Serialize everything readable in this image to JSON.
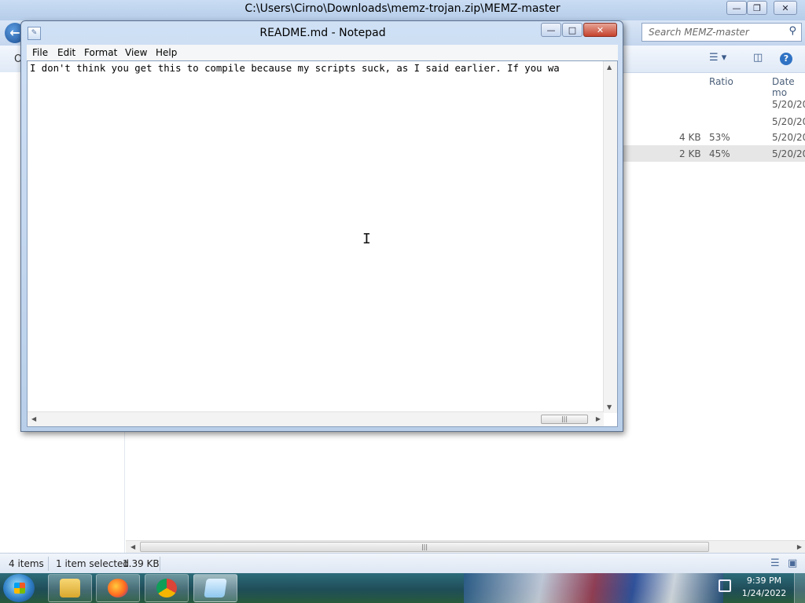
{
  "explorer": {
    "title": "C:\\Users\\Cirno\\Downloads\\memz-trojan.zip\\MEMZ-master",
    "search_placeholder": "Search MEMZ-master",
    "columns": {
      "ratio": "Ratio",
      "date": "Date mo"
    },
    "rows": [
      {
        "size": "",
        "ratio": "",
        "date": "5/20/20"
      },
      {
        "size": "",
        "ratio": "",
        "date": "5/20/20"
      },
      {
        "size": "4 KB",
        "ratio": "53%",
        "date": "5/20/20"
      },
      {
        "size": "2 KB",
        "ratio": "45%",
        "date": "5/20/20"
      }
    ],
    "status": {
      "items": "4 items",
      "selected": "1 item selected",
      "size": "1.39 KB"
    },
    "left_fragment": "O"
  },
  "notepad": {
    "title": "README.md - Notepad",
    "menu": {
      "file": "File",
      "edit": "Edit",
      "format": "Format",
      "view": "View",
      "help": "Help"
    },
    "text": "I don't think you get this to compile because my scripts suck, as I said earlier. If you wa"
  },
  "taskbar": {
    "time": "9:39 PM",
    "date": "1/24/2022",
    "buttons": [
      "windows-explorer",
      "firefox",
      "chrome",
      "notepad"
    ]
  },
  "colors": {
    "close_button": "#c5422d",
    "taskbar": "#1f4d58",
    "selection": "#e6e6e6"
  }
}
